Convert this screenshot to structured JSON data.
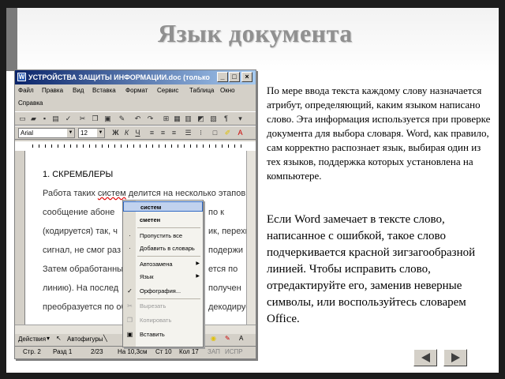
{
  "slide": {
    "title": "Язык документа",
    "paragraph1": "По мере ввода текста каждому слову назначается атрибут, определяющий, каким языком написано слово. Эта информация используется при проверке документа для выбора словаря. Word, как правило, сам корректно распознает язык, выбирая один из тех языков, поддержка которых установлена на компьютере.",
    "paragraph2": "Если Word замечает в тексте слово, написанное с ошибкой, такое слово подчеркивается красной зигзагообразной линией. Чтобы исправить слово, отредактируйте его, заменив неверные символы, или воспользуйтесь словарем Office."
  },
  "word": {
    "title": "УСТРОЙСТВА ЗАЩИТЫ ИНФОРМАЦИИ.doc (только чтение) - Micr...",
    "window_buttons": {
      "minimize": "_",
      "maximize": "□",
      "close": "×"
    },
    "menu": [
      "Файл",
      "Правка",
      "Вид",
      "Вставка",
      "Формат",
      "Сервис",
      "Таблица",
      "Окно",
      "Справка"
    ],
    "font_name": "Arial",
    "font_size": "12",
    "doc": {
      "heading": "1. СКРЕМБЛЕРЫ",
      "line1_before": "Работа таких ",
      "line1_misspelled": "систем",
      "line1_after": " делится на несколько этапов. Н",
      "lines": [
        "сообщение   абоне",
        "(кодируется)  так,  ч",
        "сигнал,  не  смог  раз",
        "Затем  обработанны",
        "линию).  На  послед",
        "преобразуется по обр"
      ],
      "right_lines": [
        "по  к",
        "ик,  перехв",
        "  подержи",
        "ется  по",
        "  получен",
        "декодирует"
      ]
    },
    "context_menu": {
      "suggestions": [
        "систем",
        "сметен"
      ],
      "items": [
        "Пропустить все",
        "Добавить в словарь",
        "Автозамена",
        "Язык",
        "Орфография...",
        "Вырезать",
        "Копировать",
        "Вставить"
      ]
    },
    "drawbar": {
      "actions": "Действия",
      "autoshapes": "Автофигуры"
    },
    "status": {
      "page": "Стр. 2",
      "section": "Разд 1",
      "pages": "2/23",
      "position": "На 10,3см",
      "line": "Ст 10",
      "column": "Кол 17",
      "rec": "ЗАП",
      "ext": "ИСПР"
    }
  }
}
